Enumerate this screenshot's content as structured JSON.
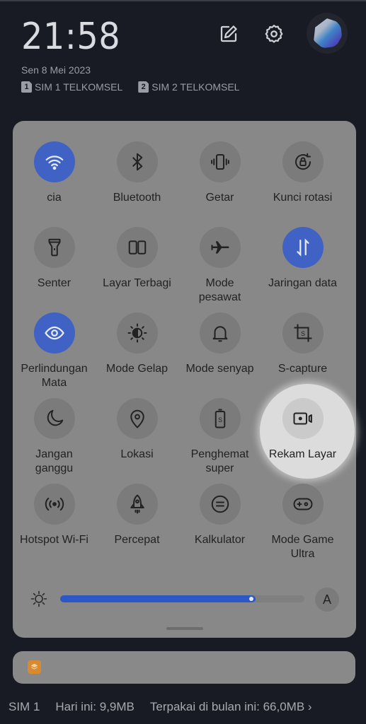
{
  "header": {
    "time": "21:58",
    "date": "Sen 8 Mei 2023",
    "sims": [
      {
        "badge": "1",
        "label": "SIM 1 TELKOMSEL"
      },
      {
        "badge": "2",
        "label": "SIM 2 TELKOMSEL"
      }
    ],
    "icons": [
      "edit-icon",
      "settings-icon",
      "avatar"
    ]
  },
  "tiles": [
    {
      "label": "cia",
      "icon": "wifi-icon",
      "active": true
    },
    {
      "label": "Bluetooth",
      "icon": "bluetooth-icon",
      "active": false
    },
    {
      "label": "Getar",
      "icon": "vibrate-icon",
      "active": false
    },
    {
      "label": "Kunci rotasi",
      "icon": "rotation-lock-icon",
      "active": false
    },
    {
      "label": "Senter",
      "icon": "flashlight-icon",
      "active": false
    },
    {
      "label": "Layar Terbagi",
      "icon": "split-screen-icon",
      "active": false
    },
    {
      "label": "Mode\npesawat",
      "icon": "airplane-icon",
      "active": false
    },
    {
      "label": "Jaringan data",
      "icon": "mobile-data-icon",
      "active": true
    },
    {
      "label": "Perlindungan\nMata",
      "icon": "eye-icon",
      "active": true
    },
    {
      "label": "Mode Gelap",
      "icon": "dark-mode-icon",
      "active": false
    },
    {
      "label": "Mode senyap",
      "icon": "bell-icon",
      "active": false
    },
    {
      "label": "S-capture",
      "icon": "screenshot-crop-icon",
      "active": false
    },
    {
      "label": "Jangan\nganggu",
      "icon": "moon-icon",
      "active": false
    },
    {
      "label": "Lokasi",
      "icon": "location-icon",
      "active": false
    },
    {
      "label": "Penghemat\nsuper",
      "icon": "battery-saver-icon",
      "active": false
    },
    {
      "label": "Rekam Layar",
      "icon": "screen-record-icon",
      "active": false,
      "highlighted": true
    },
    {
      "label": "Hotspot Wi-Fi",
      "icon": "hotspot-icon",
      "active": false
    },
    {
      "label": "Percepat",
      "icon": "rocket-icon",
      "active": false
    },
    {
      "label": "Kalkulator",
      "icon": "calculator-icon",
      "active": false
    },
    {
      "label": "Mode Game\nUltra",
      "icon": "gamepad-icon",
      "active": false
    }
  ],
  "brightness": {
    "level_percent": 80,
    "auto_label": "A"
  },
  "colors": {
    "accent": "#3f62c4",
    "slider": "#2e57c6",
    "notif_icon": "#d88a2e"
  },
  "footer": {
    "sim": "SIM 1",
    "today": "Hari ini: 9,9MB",
    "month": "Terpakai di bulan ini: 66,0MB",
    "chevron": "›"
  }
}
